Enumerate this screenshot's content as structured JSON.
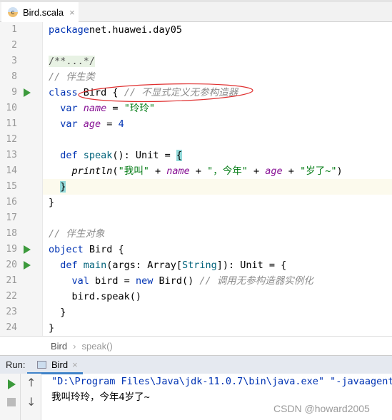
{
  "tab": {
    "icon": "scala-class-icon",
    "letter": "c",
    "title": "Bird.scala",
    "close": "×"
  },
  "line_numbers": [
    "1",
    "2",
    "3",
    "8",
    "9",
    "10",
    "11",
    "12",
    "13",
    "14",
    "15",
    "16",
    "17",
    "18",
    "19",
    "20",
    "21",
    "22",
    "23",
    "24"
  ],
  "run_markers_on": [
    "9",
    "19",
    "20"
  ],
  "current_line": "15",
  "code": [
    [
      [
        "kw",
        "package"
      ],
      [
        "",
        "net.huawei.day05"
      ]
    ],
    [],
    [
      [
        "fold",
        "/**...*/"
      ]
    ],
    [
      [
        "cm",
        "// 伴生类"
      ]
    ],
    [
      [
        "kw",
        "class "
      ],
      [
        "",
        "Bird { "
      ],
      [
        "cm",
        "// 不显式定义无参构造器"
      ]
    ],
    [
      [
        "",
        "  "
      ],
      [
        "kw",
        "var "
      ],
      [
        "fld",
        "name"
      ],
      [
        "",
        " = "
      ],
      [
        "str",
        "\"玲玲\""
      ]
    ],
    [
      [
        "",
        "  "
      ],
      [
        "kw",
        "var "
      ],
      [
        "fld",
        "age"
      ],
      [
        "",
        " = "
      ],
      [
        "kw",
        "4"
      ]
    ],
    [],
    [
      [
        "",
        "  "
      ],
      [
        "kw",
        "def "
      ],
      [
        "fn",
        "speak"
      ],
      [
        "",
        "(): Unit = "
      ],
      [
        "br",
        "{"
      ]
    ],
    [
      [
        "",
        "    "
      ],
      [
        "it",
        "println"
      ],
      [
        "",
        "("
      ],
      [
        "str",
        "\"我叫\""
      ],
      [
        "",
        " + "
      ],
      [
        "fld",
        "name"
      ],
      [
        "",
        " + "
      ],
      [
        "str",
        "\"，今年\""
      ],
      [
        "",
        " + "
      ],
      [
        "fld",
        "age"
      ],
      [
        "",
        " + "
      ],
      [
        "str",
        "\"岁了~\""
      ],
      [
        "",
        ")"
      ]
    ],
    [
      [
        "",
        "  "
      ],
      [
        "br",
        "}"
      ]
    ],
    [
      [
        "",
        "}"
      ]
    ],
    [],
    [
      [
        "cm",
        "// 伴生对象"
      ]
    ],
    [
      [
        "kw",
        "object "
      ],
      [
        "",
        "Bird {"
      ]
    ],
    [
      [
        "",
        "  "
      ],
      [
        "kw",
        "def "
      ],
      [
        "fn",
        "main"
      ],
      [
        "",
        "(args: Array["
      ],
      [
        "fn",
        "String"
      ],
      [
        "",
        "]): Unit = {"
      ]
    ],
    [
      [
        "",
        "    "
      ],
      [
        "kw",
        "val "
      ],
      [
        "",
        "bird = "
      ],
      [
        "kw",
        "new "
      ],
      [
        "",
        "Bird() "
      ],
      [
        "cm",
        "// 调用无参构造器实例化"
      ]
    ],
    [
      [
        "",
        "    bird.speak()"
      ]
    ],
    [
      [
        "",
        "  }"
      ]
    ],
    [
      [
        "",
        "}"
      ]
    ]
  ],
  "breadcrumb": {
    "items": [
      "Bird",
      "speak()"
    ],
    "separator": "›"
  },
  "run_panel": {
    "label": "Run:",
    "tab": "Bird",
    "close": "×"
  },
  "console": [
    "\"D:\\Program Files\\Java\\jdk-11.0.7\\bin\\java.exe\" \"-javaagent:",
    "我叫玲玲，今年4岁了~"
  ],
  "watermark": "CSDN @howard2005",
  "colors": {
    "keyword": "#0033b3",
    "string": "#067d17",
    "comment": "#8c8c8c",
    "field": "#871094",
    "annotation_ellipse": "#e03030",
    "run_tab_underline": "#4083c9"
  }
}
